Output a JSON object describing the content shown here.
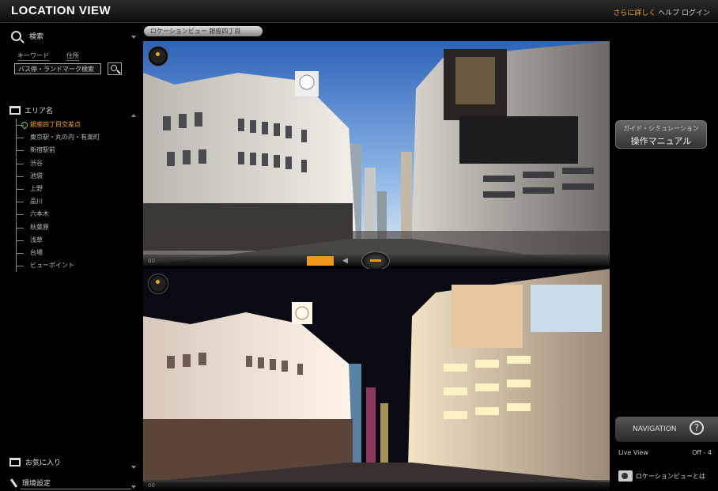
{
  "app": {
    "title": "LOCATION VIEW"
  },
  "top_links": {
    "link_highlight": "さらに詳しく",
    "link_rest": "ヘルプ ログイン"
  },
  "sidebar": {
    "search_label": "検索",
    "search_tabs": [
      "キーワード",
      "住所"
    ],
    "search_input_value": "バス停・ランドマーク検索",
    "tree_header": "エリア名",
    "tree_items": [
      "銀座四丁目交差点",
      "東京駅・丸の内・有楽町",
      "新宿駅前",
      "渋谷",
      "池袋",
      "上野",
      "品川",
      "六本木",
      "秋葉原",
      "浅草",
      "台場",
      "ビューポイント"
    ],
    "bottom_item_1": "お気に入り",
    "bottom_item_2": "環境設定"
  },
  "main": {
    "view_tab": "ロケーションビュー 銀座四丁目",
    "top_counter": "00",
    "bottom_counter": "00"
  },
  "right": {
    "manual_line1": "ガイド・シミュレーション",
    "manual_line2": "操作マニュアル",
    "navi_label": "NAVIGATION",
    "help_symbol": "?",
    "info_label": "Live View",
    "info_value": "Off - 4",
    "bottom_link": "ロケーションビューとは"
  },
  "colors": {
    "accent": "#f0961a",
    "tree_active": "#f5a623"
  }
}
